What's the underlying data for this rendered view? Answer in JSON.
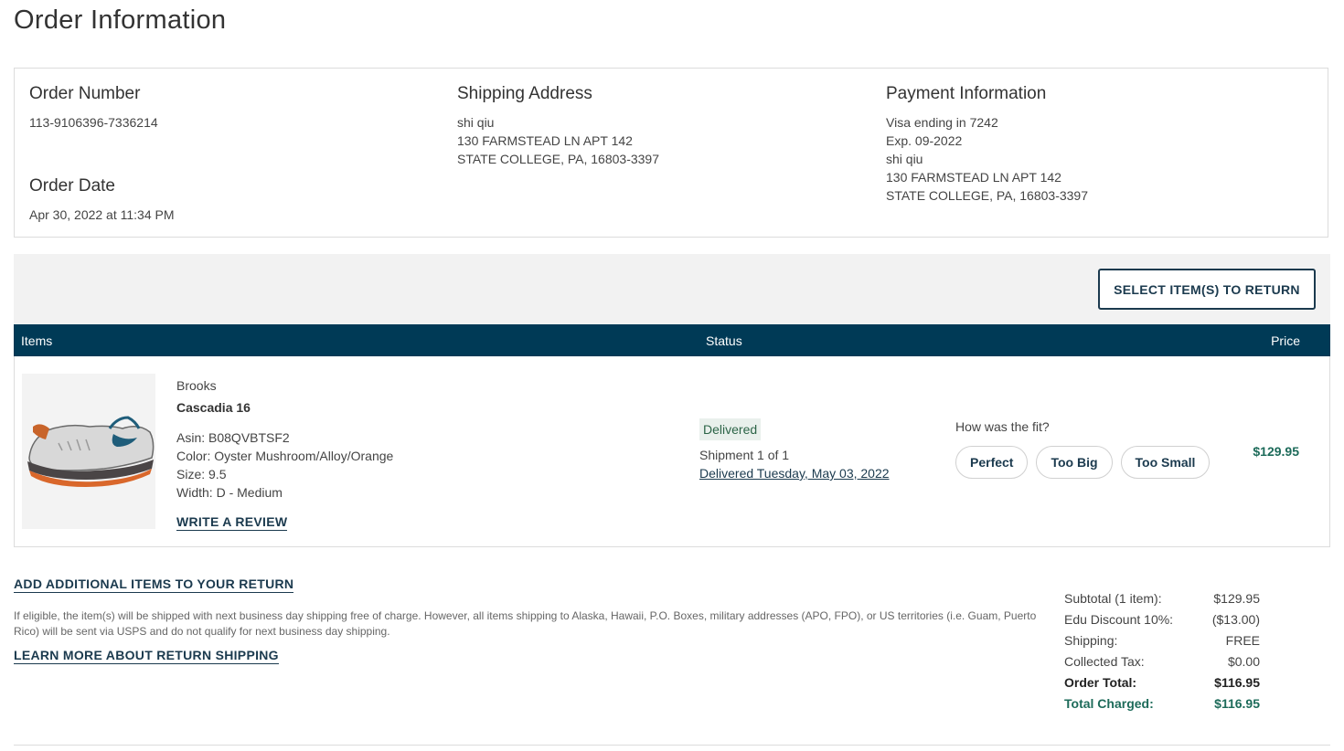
{
  "page": {
    "title": "Order Information"
  },
  "order": {
    "number_heading": "Order Number",
    "number": "113-9106396-7336214",
    "date_heading": "Order Date",
    "date": "Apr 30, 2022 at 11:34 PM"
  },
  "shipping": {
    "heading": "Shipping Address",
    "lines": [
      "shi qiu",
      "130 FARMSTEAD LN APT 142",
      "STATE COLLEGE, PA, 16803-3397"
    ]
  },
  "payment": {
    "heading": "Payment Information",
    "lines": [
      "Visa ending in 7242",
      "Exp. 09-2022",
      "shi qiu",
      "130 FARMSTEAD LN APT 142",
      "STATE COLLEGE, PA, 16803-3397"
    ]
  },
  "return_bar": {
    "button_label": "SELECT ITEM(S) TO RETURN"
  },
  "table": {
    "headers": {
      "items": "Items",
      "status": "Status",
      "price": "Price"
    }
  },
  "item": {
    "brand": "Brooks",
    "name": "Cascadia 16",
    "asin": "Asin: B08QVBTSF2",
    "color": "Color: Oyster Mushroom/Alloy/Orange",
    "size": "Size: 9.5",
    "width": "Width: D - Medium",
    "review_link": "WRITE A REVIEW",
    "status_badge": "Delivered",
    "shipment": "Shipment 1 of 1",
    "delivered_link": "Delivered Tuesday, May 03, 2022",
    "fit_question": "How was the fit?",
    "fit_options": [
      "Perfect",
      "Too Big",
      "Too Small"
    ],
    "price": "$129.95"
  },
  "return_info": {
    "add_items_link": "ADD ADDITIONAL ITEMS TO YOUR RETURN",
    "note": "If eligible, the item(s) will be shipped with next business day shipping free of charge. However, all items shipping to Alaska, Hawaii, P.O. Boxes, military addresses (APO, FPO), or US territories (i.e. Guam, Puerto Rico) will be sent via USPS and do not qualify for next business day shipping.",
    "learn_more_link": "LEARN MORE ABOUT RETURN SHIPPING"
  },
  "summary": {
    "rows": [
      {
        "label": "Subtotal (1 item):",
        "value": "$129.95"
      },
      {
        "label": "Edu Discount 10%:",
        "value": "($13.00)"
      },
      {
        "label": "Shipping:",
        "value": "FREE"
      },
      {
        "label": "Collected Tax:",
        "value": "$0.00"
      },
      {
        "label": "Order Total:",
        "value": "$116.95"
      },
      {
        "label": "Total Charged:",
        "value": "$116.95"
      }
    ]
  },
  "colors": {
    "navy": "#003a56",
    "link": "#1b3a4e",
    "price_green": "#1d6b5a",
    "badge_bg": "#e9f0ec"
  }
}
